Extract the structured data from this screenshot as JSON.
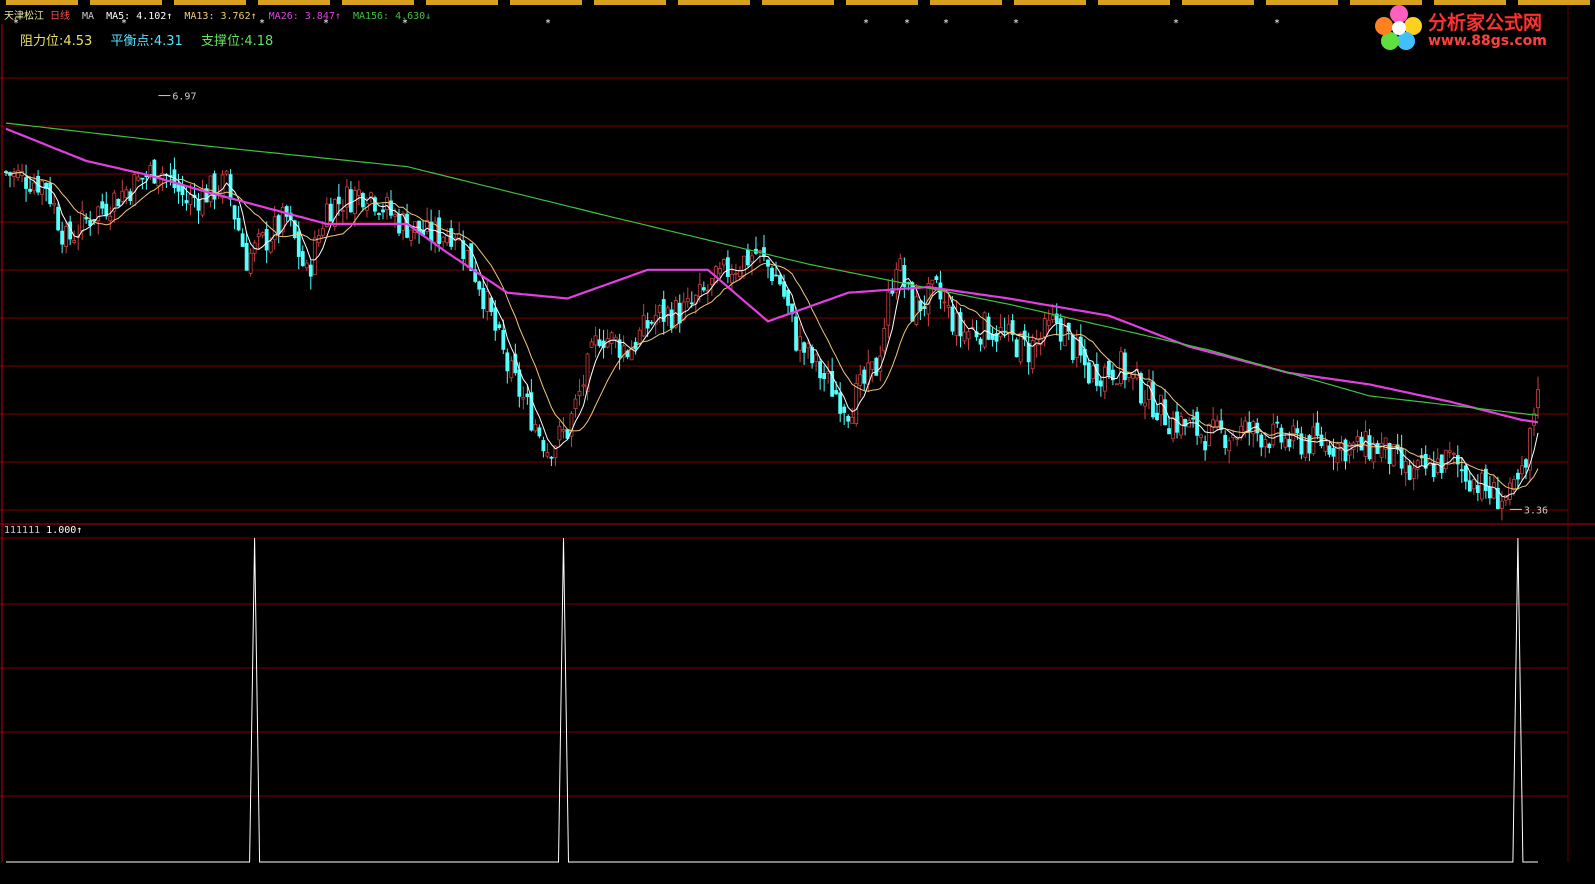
{
  "header": {
    "stock_name": "天津松江",
    "period": "日线",
    "ma_label": "MA",
    "ma5": "MA5: 4.102↑",
    "ma13": "MA13: 3.762↑",
    "ma26": "MA26: 3.847↑",
    "ma156": "MA156: 4.630↓"
  },
  "levels": {
    "resistance": "阻力位:4.53",
    "balance": "平衡点:4.31",
    "support": "支撑位:4.18"
  },
  "logo": {
    "title": "分析家公式网",
    "url": "www.88gs.com"
  },
  "indicator": {
    "name": "111111",
    "value": "1.000↑"
  },
  "colors": {
    "up": "#c84040",
    "down": "#54ffff",
    "ma5": "#ffffff",
    "ma13": "#f0c878",
    "ma26": "#e040e0",
    "ma156": "#40c040",
    "grid": "#7a0000",
    "indicator": "#ffffff"
  },
  "chart_data": [
    {
      "type": "candlestick",
      "y_range": [
        3.25,
        7.35
      ],
      "price_markers": {
        "high": 6.97,
        "low": 3.36
      },
      "high_label": "6.97",
      "low_label": "3.36",
      "ma_series_names": [
        "MA5",
        "MA13",
        "MA26",
        "MA156"
      ],
      "ma26_anchors": [
        [
          0,
          6.68
        ],
        [
          20,
          6.4
        ],
        [
          35,
          6.28
        ],
        [
          50,
          6.13
        ],
        [
          80,
          5.85
        ],
        [
          100,
          5.85
        ],
        [
          110,
          5.6
        ],
        [
          125,
          5.25
        ],
        [
          140,
          5.2
        ],
        [
          160,
          5.45
        ],
        [
          175,
          5.45
        ],
        [
          190,
          5.0
        ],
        [
          210,
          5.25
        ],
        [
          230,
          5.3
        ],
        [
          250,
          5.2
        ],
        [
          275,
          5.05
        ],
        [
          295,
          4.78
        ],
        [
          320,
          4.55
        ],
        [
          340,
          4.45
        ],
        [
          360,
          4.3
        ],
        [
          378,
          4.14
        ],
        [
          382,
          4.12
        ]
      ],
      "ma156_anchors": [
        [
          0,
          6.73
        ],
        [
          50,
          6.53
        ],
        [
          100,
          6.35
        ],
        [
          150,
          5.92
        ],
        [
          200,
          5.5
        ],
        [
          250,
          5.15
        ],
        [
          300,
          4.75
        ],
        [
          340,
          4.35
        ],
        [
          382,
          4.18
        ]
      ],
      "candle_anchors": [
        [
          0,
          6.3
        ],
        [
          10,
          6.2
        ],
        [
          15,
          5.7
        ],
        [
          22,
          5.95
        ],
        [
          30,
          6.15
        ],
        [
          38,
          6.35
        ],
        [
          45,
          6.05
        ],
        [
          55,
          6.2
        ],
        [
          60,
          5.55
        ],
        [
          70,
          5.9
        ],
        [
          75,
          5.4
        ],
        [
          80,
          6.0
        ],
        [
          90,
          6.15
        ],
        [
          97,
          5.9
        ],
        [
          105,
          5.75
        ],
        [
          112,
          5.8
        ],
        [
          118,
          5.35
        ],
        [
          125,
          4.6
        ],
        [
          130,
          4.25
        ],
        [
          135,
          3.9
        ],
        [
          140,
          4.05
        ],
        [
          148,
          4.9
        ],
        [
          155,
          4.75
        ],
        [
          162,
          5.05
        ],
        [
          170,
          5.1
        ],
        [
          180,
          5.45
        ],
        [
          187,
          5.6
        ],
        [
          193,
          5.35
        ],
        [
          197,
          4.85
        ],
        [
          203,
          4.55
        ],
        [
          210,
          4.25
        ],
        [
          217,
          4.6
        ],
        [
          222,
          5.55
        ],
        [
          226,
          5.1
        ],
        [
          232,
          5.25
        ],
        [
          238,
          4.9
        ],
        [
          245,
          4.95
        ],
        [
          255,
          4.75
        ],
        [
          262,
          5.0
        ],
        [
          270,
          4.55
        ],
        [
          278,
          4.6
        ],
        [
          290,
          4.15
        ],
        [
          300,
          4.0
        ],
        [
          310,
          4.05
        ],
        [
          320,
          3.95
        ],
        [
          328,
          3.95
        ],
        [
          335,
          3.9
        ],
        [
          343,
          3.9
        ],
        [
          350,
          3.65
        ],
        [
          360,
          3.8
        ],
        [
          365,
          3.65
        ],
        [
          370,
          3.5
        ],
        [
          375,
          3.45
        ],
        [
          379,
          3.7
        ],
        [
          382,
          4.5
        ]
      ],
      "overlay_markers_row": "* * * * * * * * *"
    },
    {
      "type": "line",
      "name": "111111",
      "y_range": [
        0,
        1
      ],
      "value": 1.0,
      "spike_bars": [
        62,
        139,
        377
      ]
    }
  ]
}
